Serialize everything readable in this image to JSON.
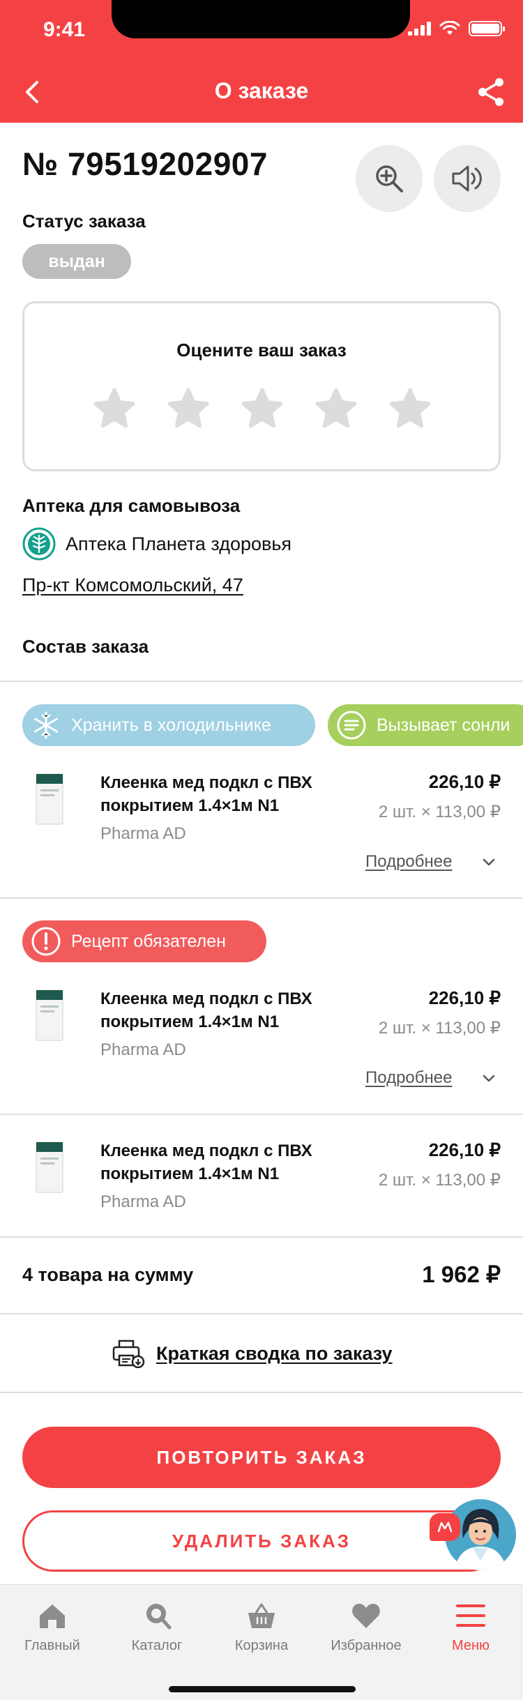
{
  "status_bar": {
    "time": "9:41"
  },
  "header": {
    "title": "О заказе"
  },
  "order": {
    "number": "№ 79519202907",
    "status_label": "Статус заказа",
    "status": "выдан"
  },
  "rating": {
    "title": "Оцените ваш заказ",
    "stars_total": 5,
    "stars_selected": 0
  },
  "pharmacy": {
    "label": "Аптека для самовывоза",
    "name": "Аптека Планета здоровья",
    "address": "Пр-кт Комсомольский, 47"
  },
  "composition": {
    "label": "Состав заказа",
    "tags": {
      "cold": "Хранить в холодильнике",
      "sleep": "Вызывает сонли",
      "rx": "Рецепт обязателен"
    },
    "details_label": "Подробнее",
    "items": [
      {
        "name": "Клеенка мед подкл с ПВХ покрытием 1.4×1м N1",
        "maker": "Pharma AD",
        "price": "226,10 ₽",
        "qty": "2 шт. × 113,00 ₽"
      },
      {
        "name": "Клеенка мед подкл с ПВХ покрытием 1.4×1м N1",
        "maker": "Pharma AD",
        "price": "226,10 ₽",
        "qty": "2 шт. × 113,00 ₽"
      },
      {
        "name": "Клеенка мед подкл с ПВХ покрытием 1.4×1м N1",
        "maker": "Pharma AD",
        "price": "226,10 ₽",
        "qty": "2 шт. × 113,00 ₽"
      }
    ]
  },
  "total": {
    "label": "4 товара на сумму",
    "value": "1 962 ₽"
  },
  "summary": {
    "link": "Краткая сводка по заказу"
  },
  "actions": {
    "repeat": "ПОВТОРИТЬ ЗАКАЗ",
    "delete": "УДАЛИТЬ ЗАКАЗ"
  },
  "tabbar": {
    "items": [
      {
        "label": "Главный",
        "icon": "home-icon"
      },
      {
        "label": "Каталог",
        "icon": "catalog-icon"
      },
      {
        "label": "Корзина",
        "icon": "cart-icon"
      },
      {
        "label": "Избранное",
        "icon": "heart-icon"
      },
      {
        "label": "Меню",
        "icon": "menu-icon"
      }
    ],
    "active": "Меню"
  },
  "colors": {
    "accent": "#f44244",
    "cold_tag": "#9fd0e3",
    "sleep_tag": "#a6cf5d",
    "rx_tag": "#f25b5c",
    "status_badge": "#bdbdbd",
    "assistant_bg": "#4aa7c9"
  }
}
